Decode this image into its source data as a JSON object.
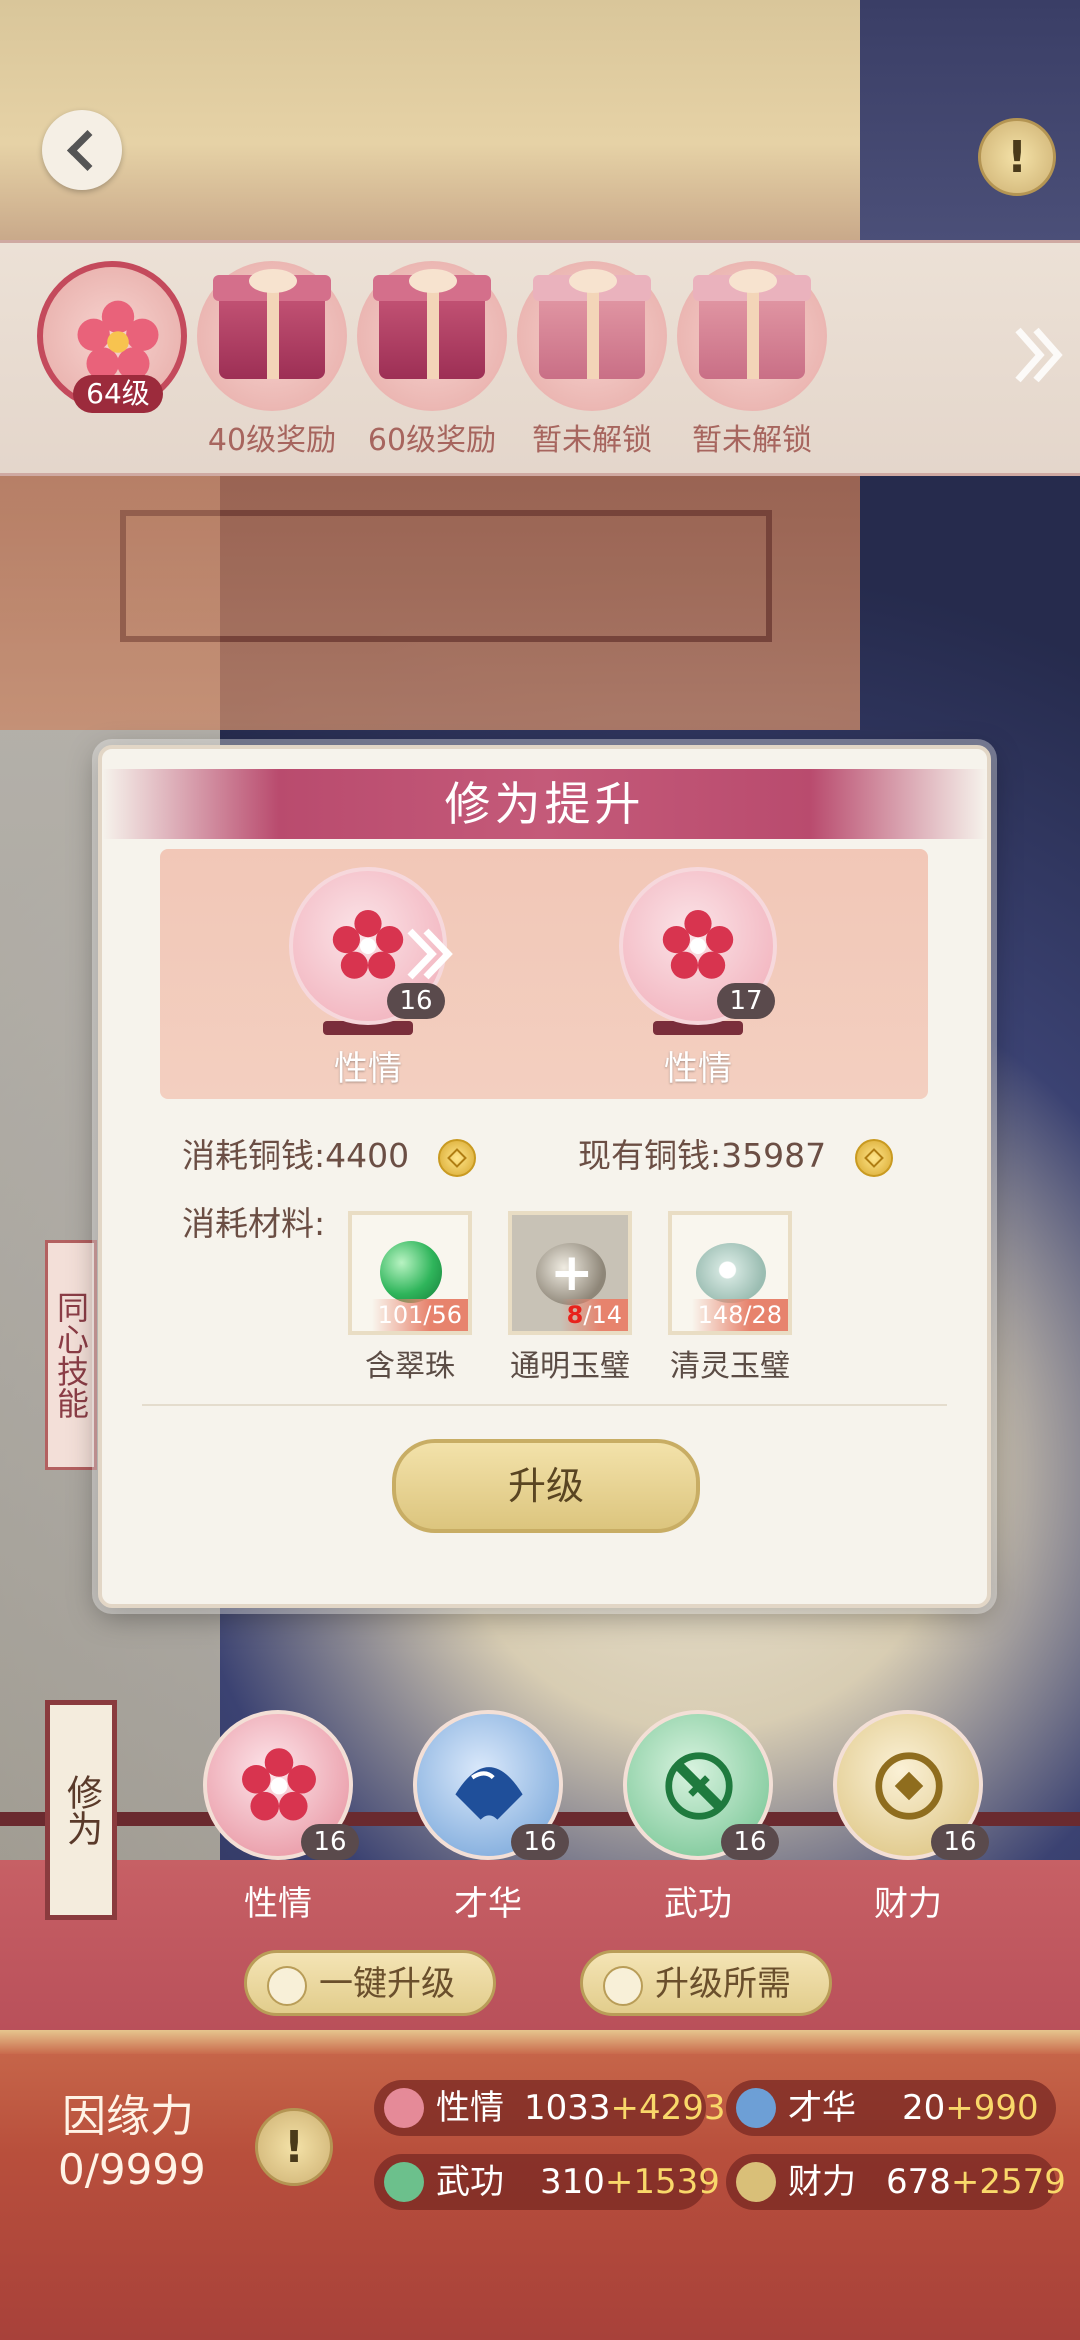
{
  "rewards": [
    {
      "label": "64级",
      "type": "current"
    },
    {
      "label": "40级奖励",
      "type": "gift"
    },
    {
      "label": "60级奖励",
      "type": "gift"
    },
    {
      "label": "暂未解锁",
      "type": "gift"
    },
    {
      "label": "暂未解锁",
      "type": "gift"
    }
  ],
  "modal": {
    "title": "修为提升",
    "from": {
      "name": "性情",
      "level": "16"
    },
    "to": {
      "name": "性情",
      "level": "17"
    },
    "cost_label": "消耗铜钱:4400",
    "owned_label": "现有铜钱:35987",
    "materials_label": "消耗材料:",
    "materials": [
      {
        "name": "含翠珠",
        "count": "101/56",
        "owned": "101",
        "needed": "56",
        "sufficient": true
      },
      {
        "name": "通明玉璧",
        "count": "8/14",
        "owned": "8",
        "needed": "14",
        "sufficient": false
      },
      {
        "name": "清灵玉璧",
        "count": "148/28",
        "owned": "148",
        "needed": "28",
        "sufficient": true
      }
    ],
    "upgrade_label": "升级"
  },
  "side_tabs": {
    "tongxin": "同心技能",
    "xiuwei": "修为"
  },
  "attributes": [
    {
      "name": "性情",
      "level": "16",
      "color": "#e58a98"
    },
    {
      "name": "才华",
      "level": "16",
      "color": "#6d9fd6"
    },
    {
      "name": "武功",
      "level": "16",
      "color": "#6cc08c"
    },
    {
      "name": "财力",
      "level": "16",
      "color": "#d9bf78"
    }
  ],
  "actions": {
    "one_key": "一键升级",
    "requirements": "升级所需"
  },
  "stats": {
    "yinyuan_label": "因缘力",
    "yinyuan_value": "0/9999",
    "items": [
      {
        "name": "性情",
        "base": "1033",
        "bonus": "+4293",
        "color": "#e58a98"
      },
      {
        "name": "才华",
        "base": "20",
        "bonus": "+990",
        "color": "#6d9fd6"
      },
      {
        "name": "武功",
        "base": "310",
        "bonus": "+1539",
        "color": "#6cc08c"
      },
      {
        "name": "财力",
        "base": "678",
        "bonus": "+2579",
        "color": "#d9bf78"
      }
    ]
  },
  "icons": {
    "back": "chevron-left-icon",
    "info": "exclamation-icon",
    "next": "double-chevron-right-icon",
    "coin": "copper-coin-icon",
    "flower": "plum-blossom-icon"
  }
}
